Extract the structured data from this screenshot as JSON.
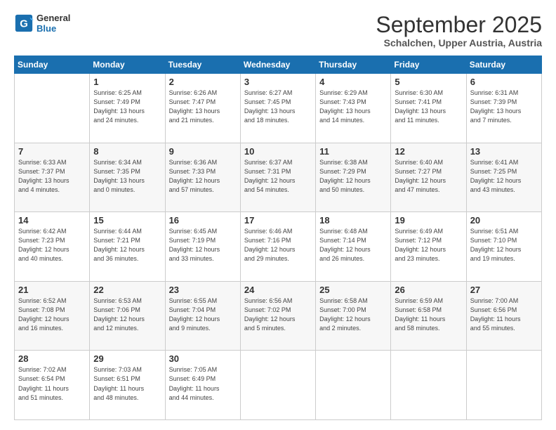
{
  "logo": {
    "line1": "General",
    "line2": "Blue"
  },
  "header": {
    "month": "September 2025",
    "location": "Schalchen, Upper Austria, Austria"
  },
  "weekdays": [
    "Sunday",
    "Monday",
    "Tuesday",
    "Wednesday",
    "Thursday",
    "Friday",
    "Saturday"
  ],
  "weeks": [
    [
      {
        "day": "",
        "info": ""
      },
      {
        "day": "1",
        "info": "Sunrise: 6:25 AM\nSunset: 7:49 PM\nDaylight: 13 hours\nand 24 minutes."
      },
      {
        "day": "2",
        "info": "Sunrise: 6:26 AM\nSunset: 7:47 PM\nDaylight: 13 hours\nand 21 minutes."
      },
      {
        "day": "3",
        "info": "Sunrise: 6:27 AM\nSunset: 7:45 PM\nDaylight: 13 hours\nand 18 minutes."
      },
      {
        "day": "4",
        "info": "Sunrise: 6:29 AM\nSunset: 7:43 PM\nDaylight: 13 hours\nand 14 minutes."
      },
      {
        "day": "5",
        "info": "Sunrise: 6:30 AM\nSunset: 7:41 PM\nDaylight: 13 hours\nand 11 minutes."
      },
      {
        "day": "6",
        "info": "Sunrise: 6:31 AM\nSunset: 7:39 PM\nDaylight: 13 hours\nand 7 minutes."
      }
    ],
    [
      {
        "day": "7",
        "info": "Sunrise: 6:33 AM\nSunset: 7:37 PM\nDaylight: 13 hours\nand 4 minutes."
      },
      {
        "day": "8",
        "info": "Sunrise: 6:34 AM\nSunset: 7:35 PM\nDaylight: 13 hours\nand 0 minutes."
      },
      {
        "day": "9",
        "info": "Sunrise: 6:36 AM\nSunset: 7:33 PM\nDaylight: 12 hours\nand 57 minutes."
      },
      {
        "day": "10",
        "info": "Sunrise: 6:37 AM\nSunset: 7:31 PM\nDaylight: 12 hours\nand 54 minutes."
      },
      {
        "day": "11",
        "info": "Sunrise: 6:38 AM\nSunset: 7:29 PM\nDaylight: 12 hours\nand 50 minutes."
      },
      {
        "day": "12",
        "info": "Sunrise: 6:40 AM\nSunset: 7:27 PM\nDaylight: 12 hours\nand 47 minutes."
      },
      {
        "day": "13",
        "info": "Sunrise: 6:41 AM\nSunset: 7:25 PM\nDaylight: 12 hours\nand 43 minutes."
      }
    ],
    [
      {
        "day": "14",
        "info": "Sunrise: 6:42 AM\nSunset: 7:23 PM\nDaylight: 12 hours\nand 40 minutes."
      },
      {
        "day": "15",
        "info": "Sunrise: 6:44 AM\nSunset: 7:21 PM\nDaylight: 12 hours\nand 36 minutes."
      },
      {
        "day": "16",
        "info": "Sunrise: 6:45 AM\nSunset: 7:19 PM\nDaylight: 12 hours\nand 33 minutes."
      },
      {
        "day": "17",
        "info": "Sunrise: 6:46 AM\nSunset: 7:16 PM\nDaylight: 12 hours\nand 29 minutes."
      },
      {
        "day": "18",
        "info": "Sunrise: 6:48 AM\nSunset: 7:14 PM\nDaylight: 12 hours\nand 26 minutes."
      },
      {
        "day": "19",
        "info": "Sunrise: 6:49 AM\nSunset: 7:12 PM\nDaylight: 12 hours\nand 23 minutes."
      },
      {
        "day": "20",
        "info": "Sunrise: 6:51 AM\nSunset: 7:10 PM\nDaylight: 12 hours\nand 19 minutes."
      }
    ],
    [
      {
        "day": "21",
        "info": "Sunrise: 6:52 AM\nSunset: 7:08 PM\nDaylight: 12 hours\nand 16 minutes."
      },
      {
        "day": "22",
        "info": "Sunrise: 6:53 AM\nSunset: 7:06 PM\nDaylight: 12 hours\nand 12 minutes."
      },
      {
        "day": "23",
        "info": "Sunrise: 6:55 AM\nSunset: 7:04 PM\nDaylight: 12 hours\nand 9 minutes."
      },
      {
        "day": "24",
        "info": "Sunrise: 6:56 AM\nSunset: 7:02 PM\nDaylight: 12 hours\nand 5 minutes."
      },
      {
        "day": "25",
        "info": "Sunrise: 6:58 AM\nSunset: 7:00 PM\nDaylight: 12 hours\nand 2 minutes."
      },
      {
        "day": "26",
        "info": "Sunrise: 6:59 AM\nSunset: 6:58 PM\nDaylight: 11 hours\nand 58 minutes."
      },
      {
        "day": "27",
        "info": "Sunrise: 7:00 AM\nSunset: 6:56 PM\nDaylight: 11 hours\nand 55 minutes."
      }
    ],
    [
      {
        "day": "28",
        "info": "Sunrise: 7:02 AM\nSunset: 6:54 PM\nDaylight: 11 hours\nand 51 minutes."
      },
      {
        "day": "29",
        "info": "Sunrise: 7:03 AM\nSunset: 6:51 PM\nDaylight: 11 hours\nand 48 minutes."
      },
      {
        "day": "30",
        "info": "Sunrise: 7:05 AM\nSunset: 6:49 PM\nDaylight: 11 hours\nand 44 minutes."
      },
      {
        "day": "",
        "info": ""
      },
      {
        "day": "",
        "info": ""
      },
      {
        "day": "",
        "info": ""
      },
      {
        "day": "",
        "info": ""
      }
    ]
  ]
}
